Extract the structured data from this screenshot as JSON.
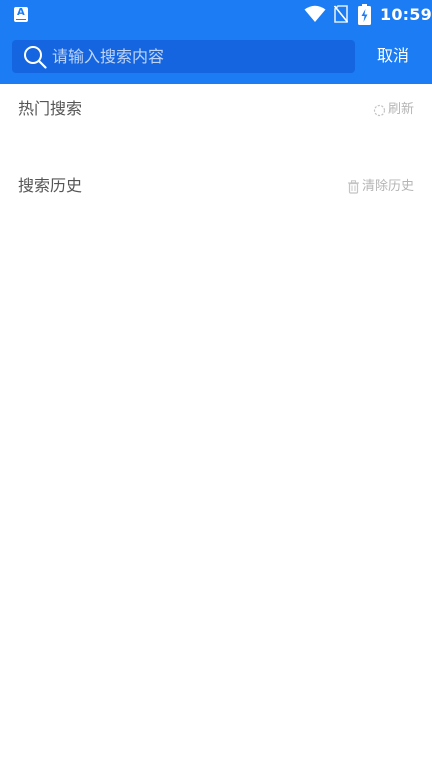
{
  "status_bar": {
    "time": "10:59",
    "notification_app_letter": "A"
  },
  "search": {
    "placeholder": "请输入搜索内容",
    "value": "",
    "cancel_label": "取消"
  },
  "hot_search": {
    "title": "热门搜索",
    "action_label": "刷新",
    "action_icon": "refresh-icon"
  },
  "history": {
    "title": "搜索历史",
    "action_label": "清除历史",
    "action_icon": "trash-icon"
  },
  "colors": {
    "header": "#1b7cf4",
    "search_box": "#1565e0",
    "title_text": "#555555",
    "action_text": "#b5b5b5"
  }
}
